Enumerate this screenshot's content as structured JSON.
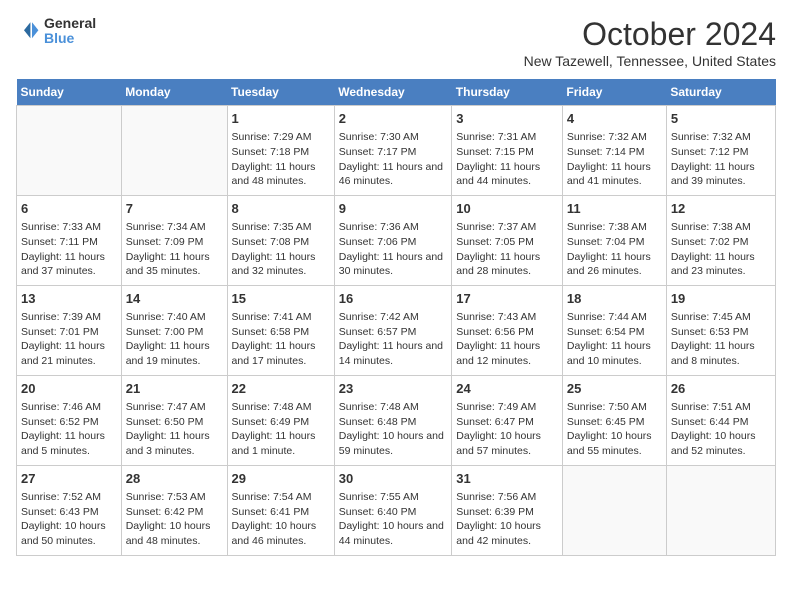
{
  "logo": {
    "text_general": "General",
    "text_blue": "Blue"
  },
  "title": "October 2024",
  "subtitle": "New Tazewell, Tennessee, United States",
  "headers": [
    "Sunday",
    "Monday",
    "Tuesday",
    "Wednesday",
    "Thursday",
    "Friday",
    "Saturday"
  ],
  "weeks": [
    [
      {
        "day": "",
        "info": ""
      },
      {
        "day": "",
        "info": ""
      },
      {
        "day": "1",
        "info": "Sunrise: 7:29 AM\nSunset: 7:18 PM\nDaylight: 11 hours and 48 minutes."
      },
      {
        "day": "2",
        "info": "Sunrise: 7:30 AM\nSunset: 7:17 PM\nDaylight: 11 hours and 46 minutes."
      },
      {
        "day": "3",
        "info": "Sunrise: 7:31 AM\nSunset: 7:15 PM\nDaylight: 11 hours and 44 minutes."
      },
      {
        "day": "4",
        "info": "Sunrise: 7:32 AM\nSunset: 7:14 PM\nDaylight: 11 hours and 41 minutes."
      },
      {
        "day": "5",
        "info": "Sunrise: 7:32 AM\nSunset: 7:12 PM\nDaylight: 11 hours and 39 minutes."
      }
    ],
    [
      {
        "day": "6",
        "info": "Sunrise: 7:33 AM\nSunset: 7:11 PM\nDaylight: 11 hours and 37 minutes."
      },
      {
        "day": "7",
        "info": "Sunrise: 7:34 AM\nSunset: 7:09 PM\nDaylight: 11 hours and 35 minutes."
      },
      {
        "day": "8",
        "info": "Sunrise: 7:35 AM\nSunset: 7:08 PM\nDaylight: 11 hours and 32 minutes."
      },
      {
        "day": "9",
        "info": "Sunrise: 7:36 AM\nSunset: 7:06 PM\nDaylight: 11 hours and 30 minutes."
      },
      {
        "day": "10",
        "info": "Sunrise: 7:37 AM\nSunset: 7:05 PM\nDaylight: 11 hours and 28 minutes."
      },
      {
        "day": "11",
        "info": "Sunrise: 7:38 AM\nSunset: 7:04 PM\nDaylight: 11 hours and 26 minutes."
      },
      {
        "day": "12",
        "info": "Sunrise: 7:38 AM\nSunset: 7:02 PM\nDaylight: 11 hours and 23 minutes."
      }
    ],
    [
      {
        "day": "13",
        "info": "Sunrise: 7:39 AM\nSunset: 7:01 PM\nDaylight: 11 hours and 21 minutes."
      },
      {
        "day": "14",
        "info": "Sunrise: 7:40 AM\nSunset: 7:00 PM\nDaylight: 11 hours and 19 minutes."
      },
      {
        "day": "15",
        "info": "Sunrise: 7:41 AM\nSunset: 6:58 PM\nDaylight: 11 hours and 17 minutes."
      },
      {
        "day": "16",
        "info": "Sunrise: 7:42 AM\nSunset: 6:57 PM\nDaylight: 11 hours and 14 minutes."
      },
      {
        "day": "17",
        "info": "Sunrise: 7:43 AM\nSunset: 6:56 PM\nDaylight: 11 hours and 12 minutes."
      },
      {
        "day": "18",
        "info": "Sunrise: 7:44 AM\nSunset: 6:54 PM\nDaylight: 11 hours and 10 minutes."
      },
      {
        "day": "19",
        "info": "Sunrise: 7:45 AM\nSunset: 6:53 PM\nDaylight: 11 hours and 8 minutes."
      }
    ],
    [
      {
        "day": "20",
        "info": "Sunrise: 7:46 AM\nSunset: 6:52 PM\nDaylight: 11 hours and 5 minutes."
      },
      {
        "day": "21",
        "info": "Sunrise: 7:47 AM\nSunset: 6:50 PM\nDaylight: 11 hours and 3 minutes."
      },
      {
        "day": "22",
        "info": "Sunrise: 7:48 AM\nSunset: 6:49 PM\nDaylight: 11 hours and 1 minute."
      },
      {
        "day": "23",
        "info": "Sunrise: 7:48 AM\nSunset: 6:48 PM\nDaylight: 10 hours and 59 minutes."
      },
      {
        "day": "24",
        "info": "Sunrise: 7:49 AM\nSunset: 6:47 PM\nDaylight: 10 hours and 57 minutes."
      },
      {
        "day": "25",
        "info": "Sunrise: 7:50 AM\nSunset: 6:45 PM\nDaylight: 10 hours and 55 minutes."
      },
      {
        "day": "26",
        "info": "Sunrise: 7:51 AM\nSunset: 6:44 PM\nDaylight: 10 hours and 52 minutes."
      }
    ],
    [
      {
        "day": "27",
        "info": "Sunrise: 7:52 AM\nSunset: 6:43 PM\nDaylight: 10 hours and 50 minutes."
      },
      {
        "day": "28",
        "info": "Sunrise: 7:53 AM\nSunset: 6:42 PM\nDaylight: 10 hours and 48 minutes."
      },
      {
        "day": "29",
        "info": "Sunrise: 7:54 AM\nSunset: 6:41 PM\nDaylight: 10 hours and 46 minutes."
      },
      {
        "day": "30",
        "info": "Sunrise: 7:55 AM\nSunset: 6:40 PM\nDaylight: 10 hours and 44 minutes."
      },
      {
        "day": "31",
        "info": "Sunrise: 7:56 AM\nSunset: 6:39 PM\nDaylight: 10 hours and 42 minutes."
      },
      {
        "day": "",
        "info": ""
      },
      {
        "day": "",
        "info": ""
      }
    ]
  ]
}
